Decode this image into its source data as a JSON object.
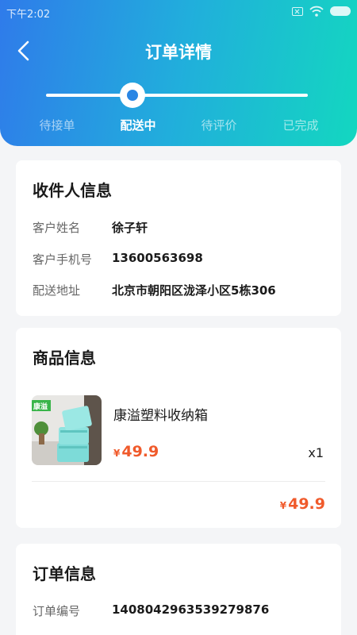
{
  "status_bar": {
    "time": "下午2:02"
  },
  "header": {
    "title": "订单详情"
  },
  "progress": {
    "steps": [
      "待接单",
      "配送中",
      "待评价",
      "已完成"
    ],
    "current_index": 1
  },
  "recipient": {
    "title": "收件人信息",
    "name_label": "客户姓名",
    "name_value": "徐子轩",
    "phone_label": "客户手机号",
    "phone_value": "13600563698",
    "address_label": "配送地址",
    "address_value": "北京市朝阳区泷泽小区5栋306"
  },
  "goods": {
    "title": "商品信息",
    "thumb_logo": "康溢",
    "item_name": "康溢塑料收纳箱",
    "currency": "¥",
    "unit_price": "49.9",
    "quantity": "x1",
    "total_price": "49.9"
  },
  "order": {
    "title": "订单信息",
    "number_label": "订单编号",
    "number_value": "1408042963539279876"
  },
  "colors": {
    "accent_start": "#2f7bea",
    "accent_end": "#13d7c0",
    "price": "#f05a2b"
  }
}
